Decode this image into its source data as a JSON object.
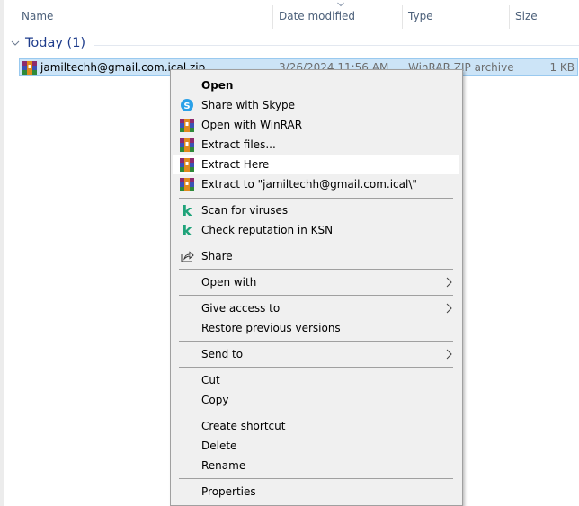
{
  "explorer": {
    "columns": [
      {
        "label": "Name"
      },
      {
        "label": "Date modified"
      },
      {
        "label": "Type"
      },
      {
        "label": "Size"
      }
    ],
    "sorted_column": "Date modified",
    "group": {
      "label": "Today (1)"
    },
    "file": {
      "name": "jamiltechh@gmail.com.ical.zip",
      "date_modified": "3/26/2024 11:56 AM",
      "type": "WinRAR ZIP archive",
      "size": "1 KB",
      "icon": "winrar-archive-icon",
      "selected": true
    }
  },
  "context_menu": {
    "items": [
      {
        "label": "Open",
        "bold": true,
        "icon": null
      },
      {
        "label": "Share with Skype",
        "icon": "skype-icon"
      },
      {
        "label": "Open with WinRAR",
        "icon": "winrar-icon"
      },
      {
        "label": "Extract files...",
        "icon": "winrar-icon"
      },
      {
        "label": "Extract Here",
        "icon": "winrar-icon",
        "highlighted": true
      },
      {
        "label": "Extract to \"jamiltechh@gmail.com.ical\\\"",
        "icon": "winrar-icon"
      },
      {
        "label": "Scan for viruses",
        "icon": "kaspersky-icon"
      },
      {
        "label": "Check reputation in KSN",
        "icon": "kaspersky-icon"
      },
      {
        "label": "Share",
        "icon": "share-icon"
      },
      {
        "label": "Open with",
        "submenu": true
      },
      {
        "label": "Give access to",
        "submenu": true
      },
      {
        "label": "Restore previous versions"
      },
      {
        "label": "Send to",
        "submenu": true
      },
      {
        "label": "Cut"
      },
      {
        "label": "Copy"
      },
      {
        "label": "Create shortcut"
      },
      {
        "label": "Delete"
      },
      {
        "label": "Rename"
      },
      {
        "label": "Properties"
      }
    ]
  },
  "colors": {
    "selection_bg": "#cce4f7",
    "selection_border": "#99c9ef",
    "group_title": "#1e3c8c",
    "menu_bg": "#f0f0f0",
    "menu_highlight": "#ffffff",
    "kaspersky_green": "#1fa37a",
    "skype_blue": "#2aa1e8"
  }
}
